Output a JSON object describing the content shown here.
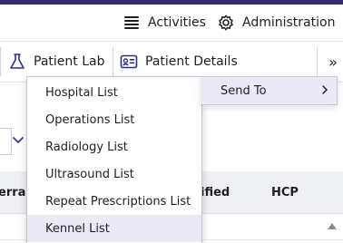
{
  "topbar": {
    "activities_label": "Activities",
    "administration_label": "Administration"
  },
  "toolbar": {
    "patient_lab_label": "Patient Lab",
    "patient_details_label": "Patient Details",
    "more_label": "»"
  },
  "table": {
    "headers": [
      "erral",
      "ified",
      "HCP"
    ]
  },
  "menu": {
    "items": [
      {
        "label": "Hospital List"
      },
      {
        "label": "Operations List"
      },
      {
        "label": "Radiology List"
      },
      {
        "label": "Ultrasound List"
      },
      {
        "label": "Repeat Prescriptions List"
      },
      {
        "label": "Kennel List"
      }
    ],
    "highlighted_index": 5
  },
  "submenu": {
    "label": "Send To",
    "chevron": ">"
  },
  "colors": {
    "accent_purple": "#3a2a6f",
    "highlight": "#ece9f7",
    "chevron_purple": "#5a3fb0"
  }
}
